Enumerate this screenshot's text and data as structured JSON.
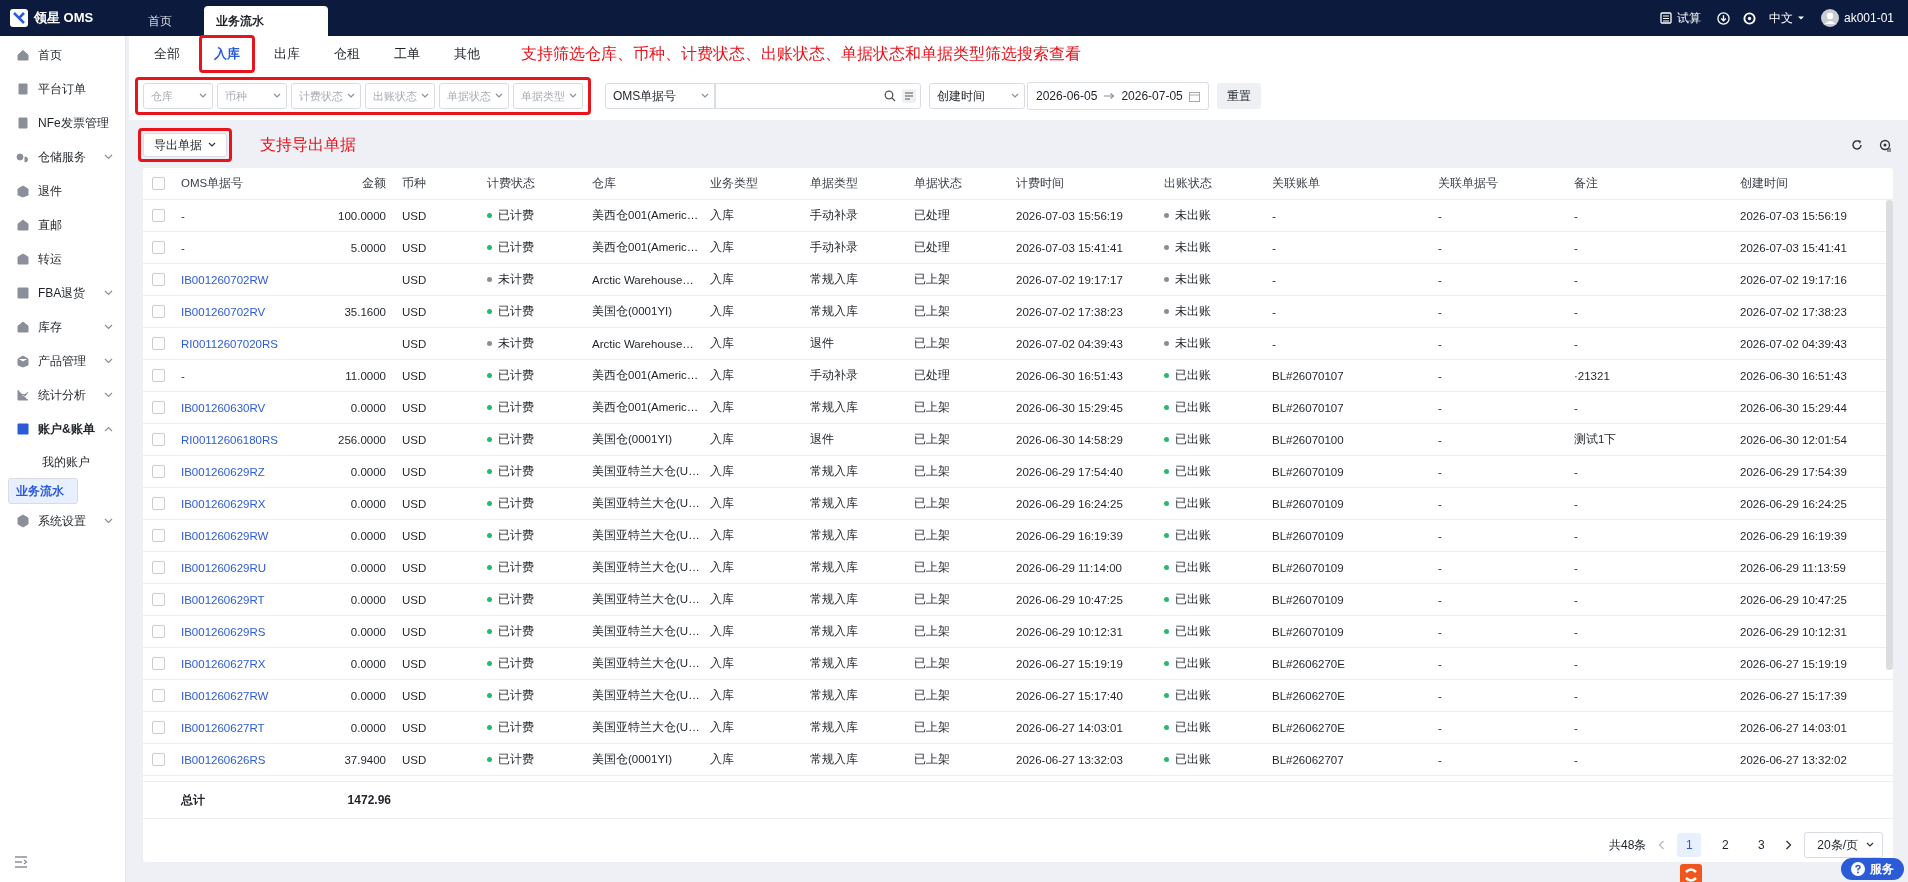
{
  "topbar": {
    "logo": "领星 OMS",
    "tabs": [
      {
        "label": "首页",
        "selected": false
      },
      {
        "label": "业务流水",
        "selected": true
      }
    ],
    "calc": "试算",
    "language": "中文",
    "user": "ak001-01"
  },
  "sidebar": {
    "items": [
      {
        "label": "首页",
        "kind": "link",
        "selected": false
      },
      {
        "label": "平台订单",
        "kind": "link",
        "selected": false
      },
      {
        "label": "NFe发票管理",
        "kind": "link",
        "selected": false
      },
      {
        "label": "仓储服务",
        "kind": "group",
        "expanded": false,
        "selected": false
      },
      {
        "label": "退件",
        "kind": "link",
        "selected": false
      },
      {
        "label": "直邮",
        "kind": "link",
        "selected": false
      },
      {
        "label": "转运",
        "kind": "link",
        "selected": false
      },
      {
        "label": "FBA退货",
        "kind": "group",
        "expanded": false,
        "selected": false
      },
      {
        "label": "库存",
        "kind": "group",
        "expanded": false,
        "selected": false
      },
      {
        "label": "产品管理",
        "kind": "group",
        "expanded": false,
        "selected": false
      },
      {
        "label": "统计分析",
        "kind": "group",
        "expanded": false,
        "selected": false
      },
      {
        "label": "账户&账单",
        "kind": "group",
        "expanded": true,
        "selected": false,
        "children": [
          {
            "label": "我的账户",
            "selected": false
          },
          {
            "label": "业务流水",
            "selected": true
          }
        ]
      },
      {
        "label": "系统设置",
        "kind": "group",
        "expanded": false,
        "selected": false
      }
    ]
  },
  "tabs": [
    {
      "label": "全部",
      "selected": false,
      "boxed": false
    },
    {
      "label": "入库",
      "selected": true,
      "boxed": true
    },
    {
      "label": "出库",
      "selected": false,
      "boxed": false
    },
    {
      "label": "仓租",
      "selected": false,
      "boxed": false
    },
    {
      "label": "工单",
      "selected": false,
      "boxed": false
    },
    {
      "label": "其他",
      "selected": false,
      "boxed": false
    }
  ],
  "tab_note": "支持筛选仓库、币种、计费状态、出账状态、单据状态和单据类型筛选搜索查看",
  "filters": {
    "boxed": true,
    "selects": [
      {
        "placeholder": "仓库"
      },
      {
        "placeholder": "币种"
      },
      {
        "placeholder": "计费状态"
      },
      {
        "placeholder": "出账状态"
      },
      {
        "placeholder": "单据状态"
      },
      {
        "placeholder": "单据类型"
      }
    ]
  },
  "search": {
    "field": "OMS单据号"
  },
  "date": {
    "field": "创建时间",
    "start": "2026-06-05",
    "end": "2026-07-05"
  },
  "reset": "重置",
  "export": {
    "label": "导出单据",
    "boxed": true
  },
  "export_note": "支持导出单据",
  "table": {
    "all_checked": false,
    "columns": [
      "OMS单据号",
      "金额",
      "币种",
      "计费状态",
      "仓库",
      "业务类型",
      "单据类型",
      "单据状态",
      "计费时间",
      "出账状态",
      "关联账单",
      "关联单据号",
      "备注",
      "创建时间"
    ],
    "rows": [
      {
        "checked": false,
        "id": "-",
        "link": false,
        "amount": "100.0000",
        "currency": "USD",
        "billing": "已计费",
        "billed": true,
        "warehouse": "美西仓001(Americ…",
        "biz": "入库",
        "doc_type": "手动补录",
        "doc_status": "已处理",
        "bill_time": "2026-07-03 15:56:19",
        "posting": "未出账",
        "posted": false,
        "bill": "-",
        "related": "-",
        "remark": "-",
        "created": "2026-07-03 15:56:19"
      },
      {
        "checked": false,
        "id": "-",
        "link": false,
        "amount": "5.0000",
        "currency": "USD",
        "billing": "已计费",
        "billed": true,
        "warehouse": "美西仓001(Americ…",
        "biz": "入库",
        "doc_type": "手动补录",
        "doc_status": "已处理",
        "bill_time": "2026-07-03 15:41:41",
        "posting": "未出账",
        "posted": false,
        "bill": "-",
        "related": "-",
        "remark": "-",
        "created": "2026-07-03 15:41:41"
      },
      {
        "checked": false,
        "id": "IB001260702RW",
        "link": true,
        "currency": "USD",
        "billing": "未计费",
        "billed": false,
        "warehouse": "Arctic Warehouse…",
        "biz": "入库",
        "doc_type": "常规入库",
        "doc_status": "已上架",
        "bill_time": "2026-07-02 19:17:17",
        "posting": "未出账",
        "posted": false,
        "bill": "-",
        "related": "-",
        "remark": "-",
        "created": "2026-07-02 19:17:16"
      },
      {
        "checked": false,
        "id": "IB001260702RV",
        "link": true,
        "amount": "35.1600",
        "currency": "USD",
        "billing": "已计费",
        "billed": true,
        "warehouse": "美国仓(0001YI)",
        "biz": "入库",
        "doc_type": "常规入库",
        "doc_status": "已上架",
        "bill_time": "2026-07-02 17:38:23",
        "posting": "未出账",
        "posted": false,
        "bill": "-",
        "related": "-",
        "remark": "-",
        "created": "2026-07-02 17:38:23"
      },
      {
        "checked": false,
        "id": "RI00112607020RS",
        "link": true,
        "currency": "USD",
        "billing": "未计费",
        "billed": false,
        "warehouse": "Arctic Warehouse…",
        "biz": "入库",
        "doc_type": "退件",
        "doc_status": "已上架",
        "bill_time": "2026-07-02 04:39:43",
        "posting": "未出账",
        "posted": false,
        "bill": "-",
        "related": "-",
        "remark": "-",
        "created": "2026-07-02 04:39:43"
      },
      {
        "checked": false,
        "id": "-",
        "link": false,
        "amount": "11.0000",
        "currency": "USD",
        "billing": "已计费",
        "billed": true,
        "warehouse": "美西仓001(Americ…",
        "biz": "入库",
        "doc_type": "手动补录",
        "doc_status": "已处理",
        "bill_time": "2026-06-30 16:51:43",
        "posting": "已出账",
        "posted": true,
        "bill": "BL#26070107",
        "related": "-",
        "remark": "·21321",
        "created": "2026-06-30 16:51:43"
      },
      {
        "checked": false,
        "id": "IB001260630RV",
        "link": true,
        "amount": "0.0000",
        "currency": "USD",
        "billing": "已计费",
        "billed": true,
        "warehouse": "美西仓001(Americ…",
        "biz": "入库",
        "doc_type": "常规入库",
        "doc_status": "已上架",
        "bill_time": "2026-06-30 15:29:45",
        "posting": "已出账",
        "posted": true,
        "bill": "BL#26070107",
        "related": "-",
        "remark": "-",
        "created": "2026-06-30 15:29:44"
      },
      {
        "checked": false,
        "id": "RI00112606180RS",
        "link": true,
        "amount": "256.0000",
        "currency": "USD",
        "billing": "已计费",
        "billed": true,
        "warehouse": "美国仓(0001YI)",
        "biz": "入库",
        "doc_type": "退件",
        "doc_status": "已上架",
        "bill_time": "2026-06-30 14:58:29",
        "posting": "已出账",
        "posted": true,
        "bill": "BL#26070100",
        "related": "-",
        "remark": "测试1下",
        "created": "2026-06-30 12:01:54"
      },
      {
        "checked": false,
        "id": "IB001260629RZ",
        "link": true,
        "amount": "0.0000",
        "currency": "USD",
        "billing": "已计费",
        "billed": true,
        "warehouse": "美国亚特兰大仓(U…",
        "biz": "入库",
        "doc_type": "常规入库",
        "doc_status": "已上架",
        "bill_time": "2026-06-29 17:54:40",
        "posting": "已出账",
        "posted": true,
        "bill": "BL#26070109",
        "related": "-",
        "remark": "-",
        "created": "2026-06-29 17:54:39"
      },
      {
        "checked": false,
        "id": "IB001260629RX",
        "link": true,
        "amount": "0.0000",
        "currency": "USD",
        "billing": "已计费",
        "billed": true,
        "warehouse": "美国亚特兰大仓(U…",
        "biz": "入库",
        "doc_type": "常规入库",
        "doc_status": "已上架",
        "bill_time": "2026-06-29 16:24:25",
        "posting": "已出账",
        "posted": true,
        "bill": "BL#26070109",
        "related": "-",
        "remark": "-",
        "created": "2026-06-29 16:24:25"
      },
      {
        "checked": false,
        "id": "IB001260629RW",
        "link": true,
        "amount": "0.0000",
        "currency": "USD",
        "billing": "已计费",
        "billed": true,
        "warehouse": "美国亚特兰大仓(U…",
        "biz": "入库",
        "doc_type": "常规入库",
        "doc_status": "已上架",
        "bill_time": "2026-06-29 16:19:39",
        "posting": "已出账",
        "posted": true,
        "bill": "BL#26070109",
        "related": "-",
        "remark": "-",
        "created": "2026-06-29 16:19:39"
      },
      {
        "checked": false,
        "id": "IB001260629RU",
        "link": true,
        "amount": "0.0000",
        "currency": "USD",
        "billing": "已计费",
        "billed": true,
        "warehouse": "美国亚特兰大仓(U…",
        "biz": "入库",
        "doc_type": "常规入库",
        "doc_status": "已上架",
        "bill_time": "2026-06-29 11:14:00",
        "posting": "已出账",
        "posted": true,
        "bill": "BL#26070109",
        "related": "-",
        "remark": "-",
        "created": "2026-06-29 11:13:59"
      },
      {
        "checked": false,
        "id": "IB001260629RT",
        "link": true,
        "amount": "0.0000",
        "currency": "USD",
        "billing": "已计费",
        "billed": true,
        "warehouse": "美国亚特兰大仓(U…",
        "biz": "入库",
        "doc_type": "常规入库",
        "doc_status": "已上架",
        "bill_time": "2026-06-29 10:47:25",
        "posting": "已出账",
        "posted": true,
        "bill": "BL#26070109",
        "related": "-",
        "remark": "-",
        "created": "2026-06-29 10:47:25"
      },
      {
        "checked": false,
        "id": "IB001260629RS",
        "link": true,
        "amount": "0.0000",
        "currency": "USD",
        "billing": "已计费",
        "billed": true,
        "warehouse": "美国亚特兰大仓(U…",
        "biz": "入库",
        "doc_type": "常规入库",
        "doc_status": "已上架",
        "bill_time": "2026-06-29 10:12:31",
        "posting": "已出账",
        "posted": true,
        "bill": "BL#26070109",
        "related": "-",
        "remark": "-",
        "created": "2026-06-29 10:12:31"
      },
      {
        "checked": false,
        "id": "IB001260627RX",
        "link": true,
        "amount": "0.0000",
        "currency": "USD",
        "billing": "已计费",
        "billed": true,
        "warehouse": "美国亚特兰大仓(U…",
        "biz": "入库",
        "doc_type": "常规入库",
        "doc_status": "已上架",
        "bill_time": "2026-06-27 15:19:19",
        "posting": "已出账",
        "posted": true,
        "bill": "BL#2606270E",
        "related": "-",
        "remark": "-",
        "created": "2026-06-27 15:19:19"
      },
      {
        "checked": false,
        "id": "IB001260627RW",
        "link": true,
        "amount": "0.0000",
        "currency": "USD",
        "billing": "已计费",
        "billed": true,
        "warehouse": "美国亚特兰大仓(U…",
        "biz": "入库",
        "doc_type": "常规入库",
        "doc_status": "已上架",
        "bill_time": "2026-06-27 15:17:40",
        "posting": "已出账",
        "posted": true,
        "bill": "BL#2606270E",
        "related": "-",
        "remark": "-",
        "created": "2026-06-27 15:17:39"
      },
      {
        "checked": false,
        "id": "IB001260627RT",
        "link": true,
        "amount": "0.0000",
        "currency": "USD",
        "billing": "已计费",
        "billed": true,
        "warehouse": "美国亚特兰大仓(U…",
        "biz": "入库",
        "doc_type": "常规入库",
        "doc_status": "已上架",
        "bill_time": "2026-06-27 14:03:01",
        "posting": "已出账",
        "posted": true,
        "bill": "BL#2606270E",
        "related": "-",
        "remark": "-",
        "created": "2026-06-27 14:03:01"
      },
      {
        "checked": false,
        "id": "IB001260626RS",
        "link": true,
        "amount": "37.9400",
        "currency": "USD",
        "billing": "已计费",
        "billed": true,
        "warehouse": "美国仓(0001YI)",
        "biz": "入库",
        "doc_type": "常规入库",
        "doc_status": "已上架",
        "bill_time": "2026-06-27 13:32:03",
        "posting": "已出账",
        "posted": true,
        "bill": "BL#26062707",
        "related": "-",
        "remark": "-",
        "created": "2026-06-27 13:32:02"
      }
    ],
    "total": {
      "label": "总计",
      "amount": "1472.96"
    }
  },
  "pagination": {
    "total": "共48条",
    "pages": [
      {
        "label": "1",
        "selected": true
      },
      {
        "label": "2",
        "selected": false
      },
      {
        "label": "3",
        "selected": false
      }
    ],
    "page_size": "20条/页"
  },
  "service": "服务"
}
